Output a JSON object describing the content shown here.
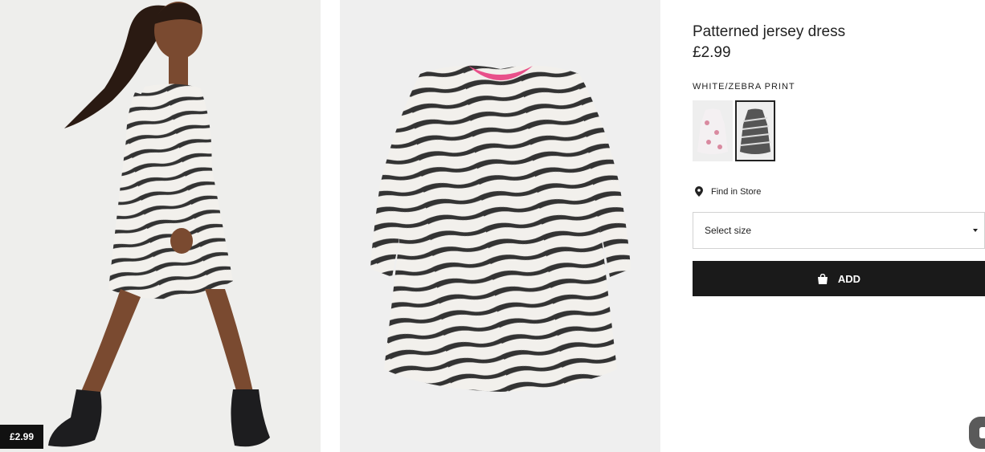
{
  "product": {
    "title": "Patterned jersey dress",
    "price": "£2.99",
    "color_name": "WHITE/ZEBRA PRINT",
    "image_price_tag": "£2.99"
  },
  "swatches": [
    {
      "label": "floral print dress",
      "selected": false
    },
    {
      "label": "zebra print dress",
      "selected": true
    }
  ],
  "find_in_store": "Find in Store",
  "size_select": {
    "placeholder": "Select size"
  },
  "add_button": {
    "label": "ADD"
  },
  "colors": {
    "button_bg": "#1a1a1a",
    "image_bg": "#efefef",
    "zebra_dark": "#333333",
    "zebra_light": "#f2f0ec",
    "neckline": "#e8508a"
  },
  "icons": {
    "location": "map-pin-icon",
    "bag": "shopping-bag-icon",
    "caret": "chevron-down-icon",
    "chat": "chat-icon"
  }
}
